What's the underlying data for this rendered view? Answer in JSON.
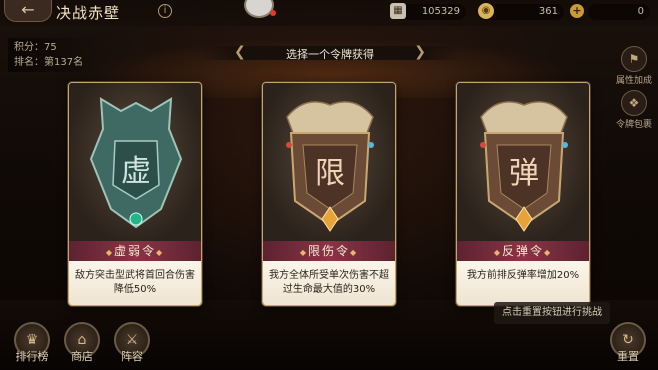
{
  "header": {
    "back_icon": "arrow-left-icon",
    "title": "决战赤壁",
    "info_icon": "i",
    "resource1_value": "105329",
    "resource2_value": "361",
    "resource3_value": "0"
  },
  "score": {
    "points": "积分：75",
    "rank": "排名：第137名"
  },
  "banner": {
    "text": "选择一个令牌获得"
  },
  "side": {
    "attr_bonus": "属性加成",
    "token_pack": "令牌包裹"
  },
  "cards": [
    {
      "glyph": "虚",
      "name": "虚弱令",
      "desc": "敌方突击型武将首回合伤害降低50%",
      "accent": "#3f6a62"
    },
    {
      "glyph": "限",
      "name": "限伤令",
      "desc": "我方全体所受单次伤害不超过生命最大值的30%",
      "accent": "#6a4a35"
    },
    {
      "glyph": "弹",
      "name": "反弹令",
      "desc": "我方前排反弹率增加20%",
      "accent": "#6a4a35"
    }
  ],
  "tooltip": "点击重置按钮进行挑战",
  "bottom": {
    "ranking": "排行榜",
    "shop": "商店",
    "lineup": "阵容",
    "reset": "重置"
  }
}
